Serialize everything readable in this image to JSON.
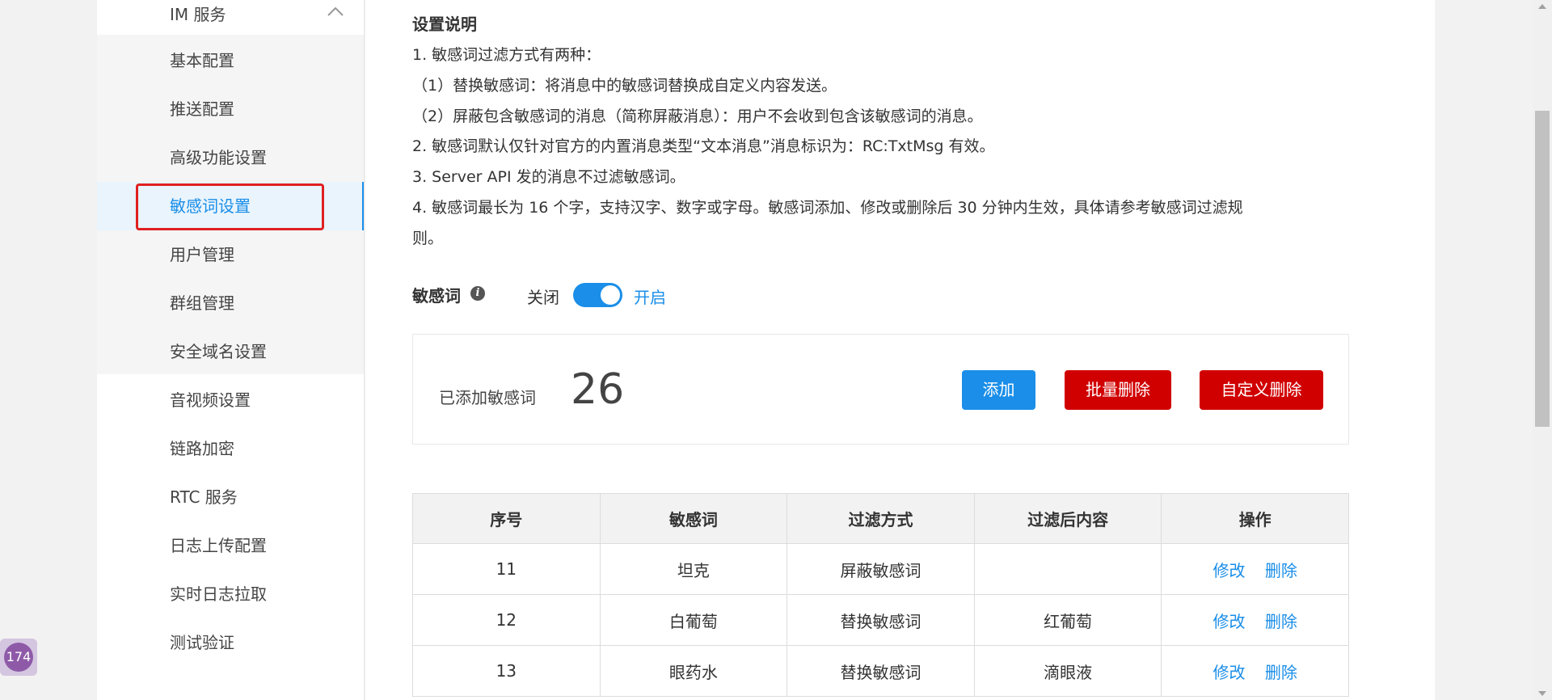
{
  "sidebar": {
    "section_title": "IM 服务",
    "items": [
      {
        "label": "基本配置"
      },
      {
        "label": "推送配置"
      },
      {
        "label": "高级功能设置"
      },
      {
        "label": "敏感词设置"
      },
      {
        "label": "用户管理"
      },
      {
        "label": "群组管理"
      },
      {
        "label": "安全域名设置"
      },
      {
        "label": "音视频设置"
      },
      {
        "label": "链路加密"
      },
      {
        "label": "RTC 服务"
      },
      {
        "label": "日志上传配置"
      },
      {
        "label": "实时日志拉取"
      },
      {
        "label": "测试验证"
      }
    ],
    "active_item": "敏感词设置"
  },
  "description": {
    "title": "设置说明",
    "lines": [
      "1. 敏感词过滤方式有两种：",
      "（1）替换敏感词：将消息中的敏感词替换成自定义内容发送。",
      "（2）屏蔽包含敏感词的消息（简称屏蔽消息）：用户不会收到包含该敏感词的消息。",
      "2. 敏感词默认仅针对官方的内置消息类型“文本消息”消息标识为：RC:TxtMsg 有效。",
      "3. Server API 发的消息不过滤敏感词。",
      "4. 敏感词最长为 16 个字，支持汉字、数字或字母。敏感词添加、修改或删除后 30 分钟内生效，具体请参考敏感词过滤规",
      "则。"
    ]
  },
  "switch": {
    "label": "敏感词",
    "info_icon": "info-icon",
    "off_label": "关闭",
    "on_label": "开启",
    "state": "on"
  },
  "stats": {
    "label": "已添加敏感词",
    "count": "26"
  },
  "buttons": {
    "add": "添加",
    "batch_delete": "批量删除",
    "custom_delete": "自定义删除"
  },
  "table": {
    "headers": [
      "序号",
      "敏感词",
      "过滤方式",
      "过滤后内容",
      "操作"
    ],
    "rows": [
      {
        "index": "11",
        "word": "坦克",
        "mode": "屏蔽敏感词",
        "replacement": "",
        "edit": "修改",
        "delete": "删除"
      },
      {
        "index": "12",
        "word": "白葡萄",
        "mode": "替换敏感词",
        "replacement": "红葡萄",
        "edit": "修改",
        "delete": "删除"
      },
      {
        "index": "13",
        "word": "眼药水",
        "mode": "替换敏感词",
        "replacement": "滴眼液",
        "edit": "修改",
        "delete": "删除"
      }
    ]
  },
  "badge": {
    "count": "174"
  },
  "colors": {
    "accent": "#1a8ee8",
    "danger": "#d10000",
    "highlight_outline": "#e02020"
  }
}
